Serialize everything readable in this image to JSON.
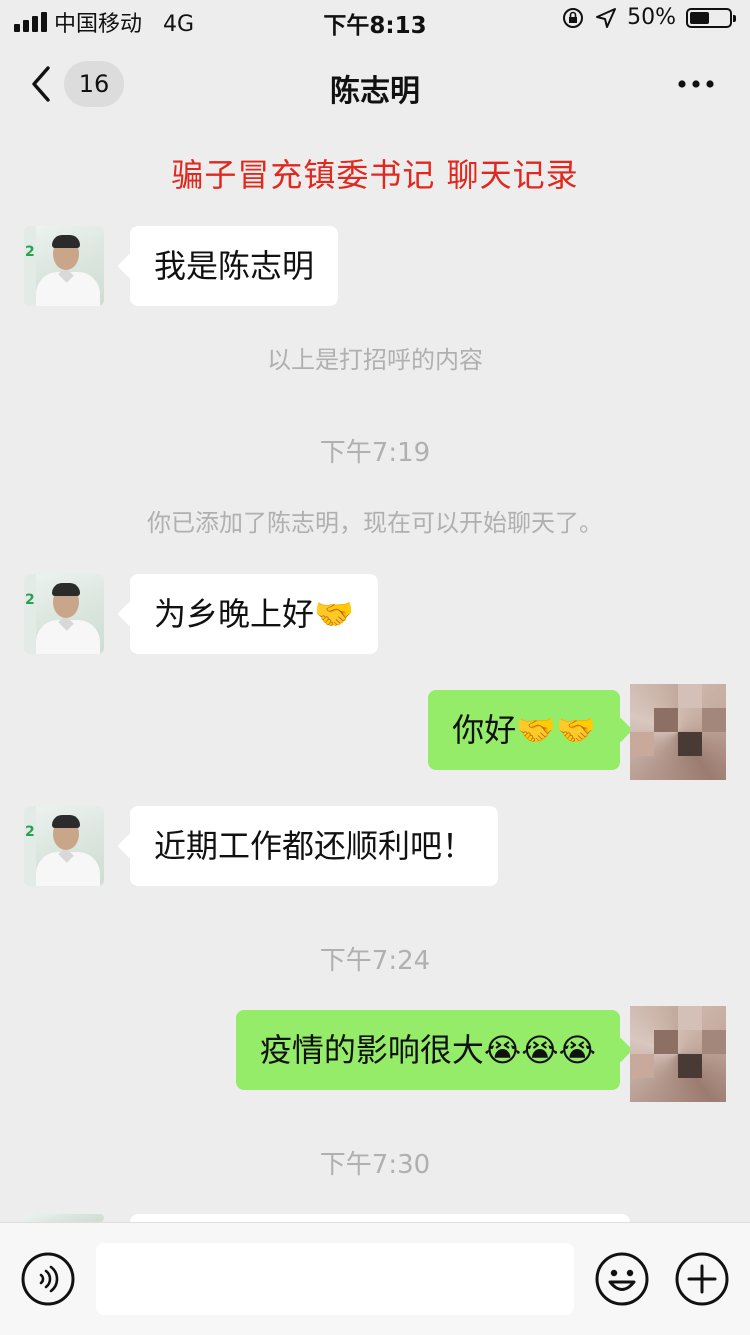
{
  "status_bar": {
    "carrier": "中国移动",
    "network": "4G",
    "time": "下午8:13",
    "battery_text": "50%",
    "battery_level": 0.5
  },
  "nav": {
    "back_count": "16",
    "title": "陈志明",
    "more_icon": "more-dots-icon"
  },
  "overlay_caption": "骗子冒充镇委书记 聊天记录",
  "messages": [
    {
      "type": "in",
      "text": "我是陈志明"
    },
    {
      "type": "system",
      "text": "以上是打招呼的内容"
    },
    {
      "type": "time",
      "text": "下午7:19"
    },
    {
      "type": "system",
      "text": "你已添加了陈志明，现在可以开始聊天了。"
    },
    {
      "type": "in",
      "text": "为乡晚上好🤝"
    },
    {
      "type": "out",
      "text": "你好🤝🤝"
    },
    {
      "type": "in",
      "text": "近期工作都还顺利吧！"
    },
    {
      "type": "time",
      "text": "下午7:24"
    },
    {
      "type": "out",
      "text": "疫情的影响很大😭😭😭"
    },
    {
      "type": "time",
      "text": "下午7:30"
    }
  ],
  "input_bar": {
    "voice_icon": "voice-icon",
    "text_value": "",
    "emoji_icon": "emoji-icon",
    "add_icon": "add-icon"
  },
  "colors": {
    "background": "#ededed",
    "incoming_bubble": "#ffffff",
    "outgoing_bubble": "#95ec69",
    "caption": "#e0281e",
    "system_text": "#b0b0b0"
  }
}
